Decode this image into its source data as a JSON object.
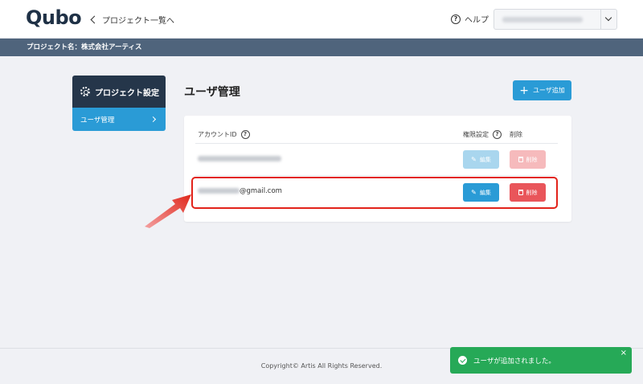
{
  "header": {
    "logo_text": "Qubo",
    "back_link": "プロジェクト一覧へ",
    "help_label": "ヘルプ",
    "help_icon_glyph": "?",
    "account_email": "",
    "close_glyph": "×"
  },
  "project_bar": {
    "label": "プロジェクト名：株式会社アーティス"
  },
  "sidebar": {
    "title": "プロジェクト設定",
    "items": [
      {
        "label": "ユーザ管理",
        "active": true
      }
    ]
  },
  "main": {
    "title": "ユーザ管理",
    "add_button": "ユーザ追加",
    "plus_glyph": "+",
    "table": {
      "col_account": "アカウントID",
      "col_permission": "権限設定",
      "col_delete": "削除",
      "q_glyph": "?",
      "rows": [
        {
          "email_suffix": "",
          "edit_label": "編集",
          "delete_label": "削除",
          "disabled": true
        },
        {
          "email_suffix": "@gmail.com",
          "edit_label": "編集",
          "delete_label": "削除",
          "disabled": false
        }
      ]
    }
  },
  "footer": {
    "copyright": "Copyright© Artis All Rights Reserved."
  },
  "toast": {
    "message": "ユーザが追加されました。",
    "close": "×"
  },
  "colors": {
    "accent": "#2a9bd6",
    "navy": "#25364a",
    "danger": "#e9555a",
    "success": "#26a957",
    "highlight": "#e2231a"
  }
}
